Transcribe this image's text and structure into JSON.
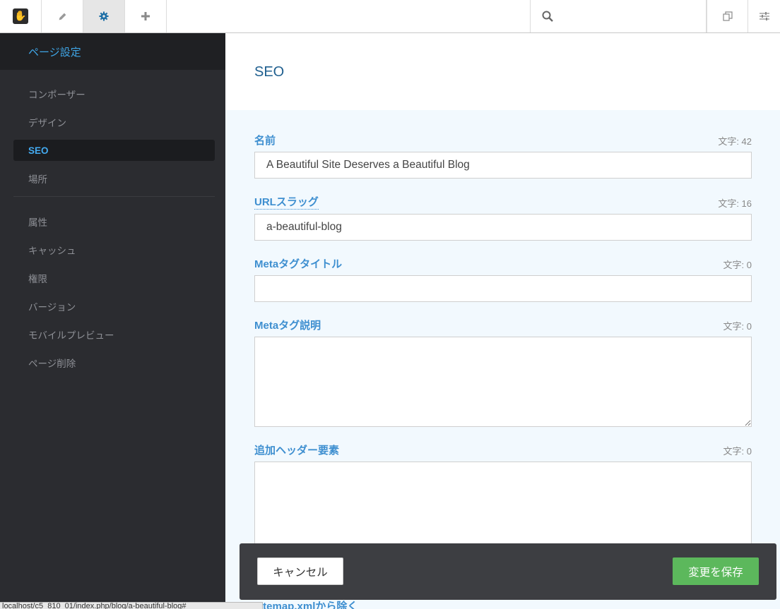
{
  "toolbar": {
    "search_placeholder": ""
  },
  "sidebar": {
    "header": "ページ設定",
    "items": [
      {
        "label": "コンポーザー"
      },
      {
        "label": "デザイン"
      },
      {
        "label": "SEO"
      },
      {
        "label": "場所"
      },
      {
        "label": "属性"
      },
      {
        "label": "キャッシュ"
      },
      {
        "label": "権限"
      },
      {
        "label": "バージョン"
      },
      {
        "label": "モバイルプレビュー"
      },
      {
        "label": "ページ削除"
      }
    ]
  },
  "main": {
    "title": "SEO",
    "fields": [
      {
        "label": "名前",
        "counter": "文字: 42",
        "value": "A Beautiful Site Deserves a Beautiful Blog"
      },
      {
        "label": "URLスラッグ",
        "counter": "文字: 16",
        "value": "a-beautiful-blog"
      },
      {
        "label": "Metaタグタイトル",
        "counter": "文字: 0",
        "value": ""
      },
      {
        "label": "Metaタグ説明",
        "counter": "文字: 0",
        "value": ""
      },
      {
        "label": "追加ヘッダー要素",
        "counter": "文字: 0",
        "value": ""
      }
    ],
    "peek_label": "itemap.xmlから除く"
  },
  "footer": {
    "cancel_label": "キャンセル",
    "save_label": "変更を保存"
  },
  "status_url": "localhost/c5_810_01/index.php/blog/a-beautiful-blog#",
  "colors": {
    "accent": "#3e8fd0",
    "save": "#5cb85c",
    "sidebar_bg": "#2b2c30"
  }
}
